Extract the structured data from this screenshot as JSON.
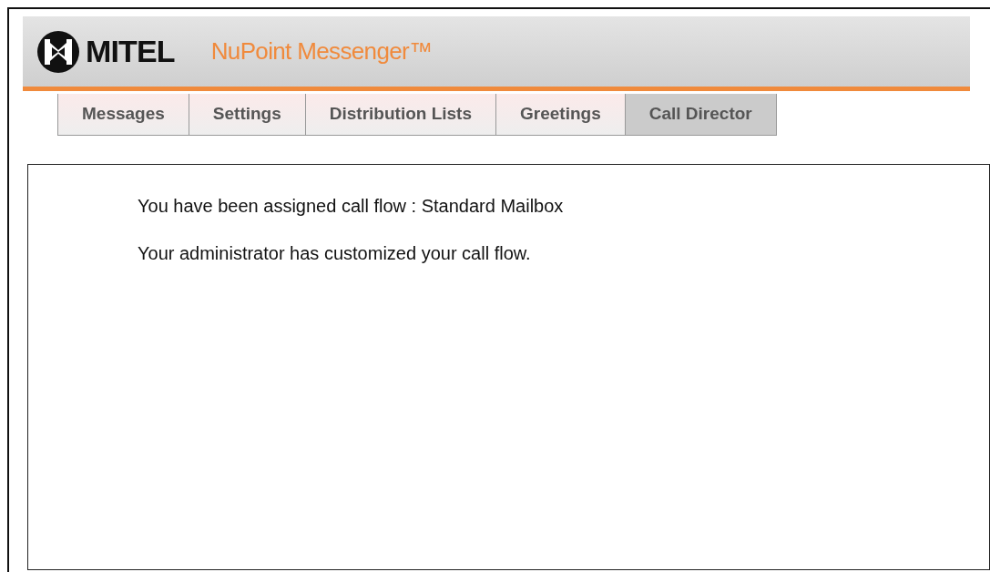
{
  "header": {
    "logo_text": "MITEL",
    "product": "NuPoint Messenger™"
  },
  "tabs": [
    {
      "label": "Messages",
      "selected": false
    },
    {
      "label": "Settings",
      "selected": false
    },
    {
      "label": "Distribution Lists",
      "selected": false
    },
    {
      "label": "Greetings",
      "selected": false
    },
    {
      "label": "Call Director",
      "selected": true
    }
  ],
  "content": {
    "lines": [
      "You have been assigned call flow : Standard Mailbox",
      "Your administrator has customized your call flow."
    ]
  }
}
